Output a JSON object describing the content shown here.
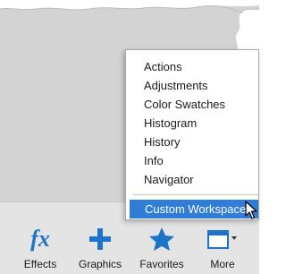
{
  "colors": {
    "panel_background": "#d3d3d3",
    "bar_background": "#e4e4e4",
    "accent_blue": "#1c74c9",
    "menu_highlight": "#2f7dd6"
  },
  "menu": {
    "items": [
      {
        "label": "Actions"
      },
      {
        "label": "Adjustments"
      },
      {
        "label": "Color Swatches"
      },
      {
        "label": "Histogram"
      },
      {
        "label": "History"
      },
      {
        "label": "Info"
      },
      {
        "label": "Navigator"
      }
    ],
    "selected": {
      "label": "Custom Workspace"
    }
  },
  "bottom_bar": {
    "effects": {
      "label": "Effects",
      "icon": "fx-icon"
    },
    "graphics": {
      "label": "Graphics",
      "icon": "plus-icon"
    },
    "favorites": {
      "label": "Favorites",
      "icon": "star-icon"
    },
    "more": {
      "label": "More",
      "icon": "panel-menu-icon"
    }
  }
}
